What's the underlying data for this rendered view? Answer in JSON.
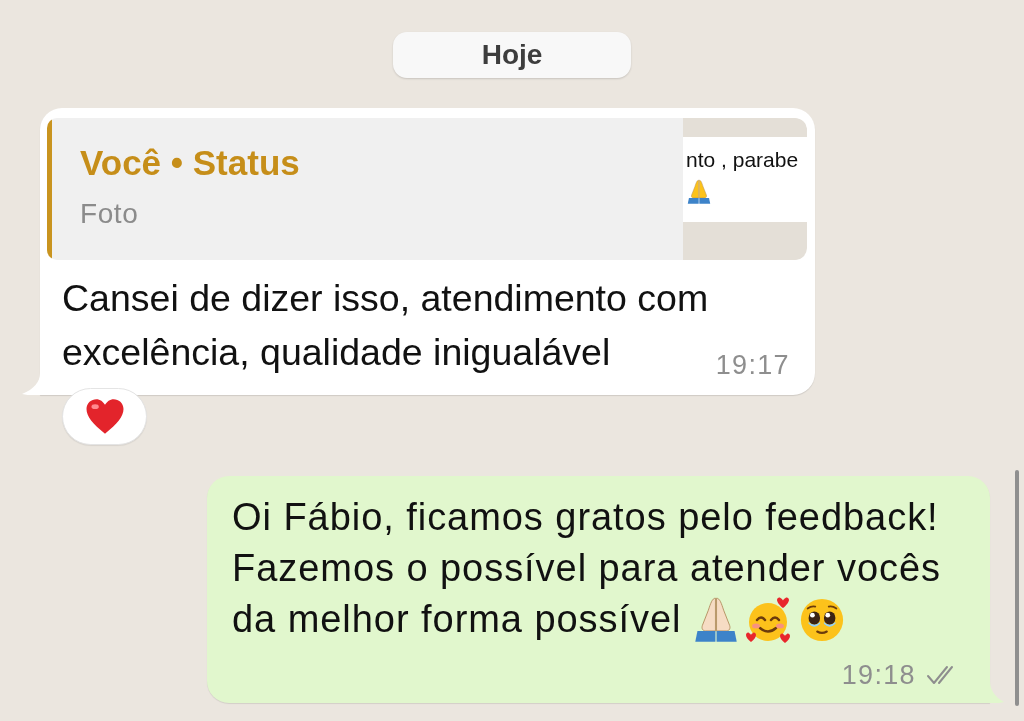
{
  "date_divider": "Hoje",
  "messages": [
    {
      "kind": "incoming",
      "reply": {
        "title": "Você • Status",
        "subtitle": "Foto",
        "thumbnail_text": "nto , parabe"
      },
      "text": "Cansei de dizer isso, atendimento com excelência, qualidade inigualável",
      "time": "19:17",
      "reacted": true
    },
    {
      "kind": "outgoing",
      "lines": [
        "Oi Fábio, ficamos gratos pelo feedback!",
        "Fazemos o possível para atender vocês",
        "da melhor forma possível"
      ],
      "time": "19:18",
      "read": false
    }
  ]
}
